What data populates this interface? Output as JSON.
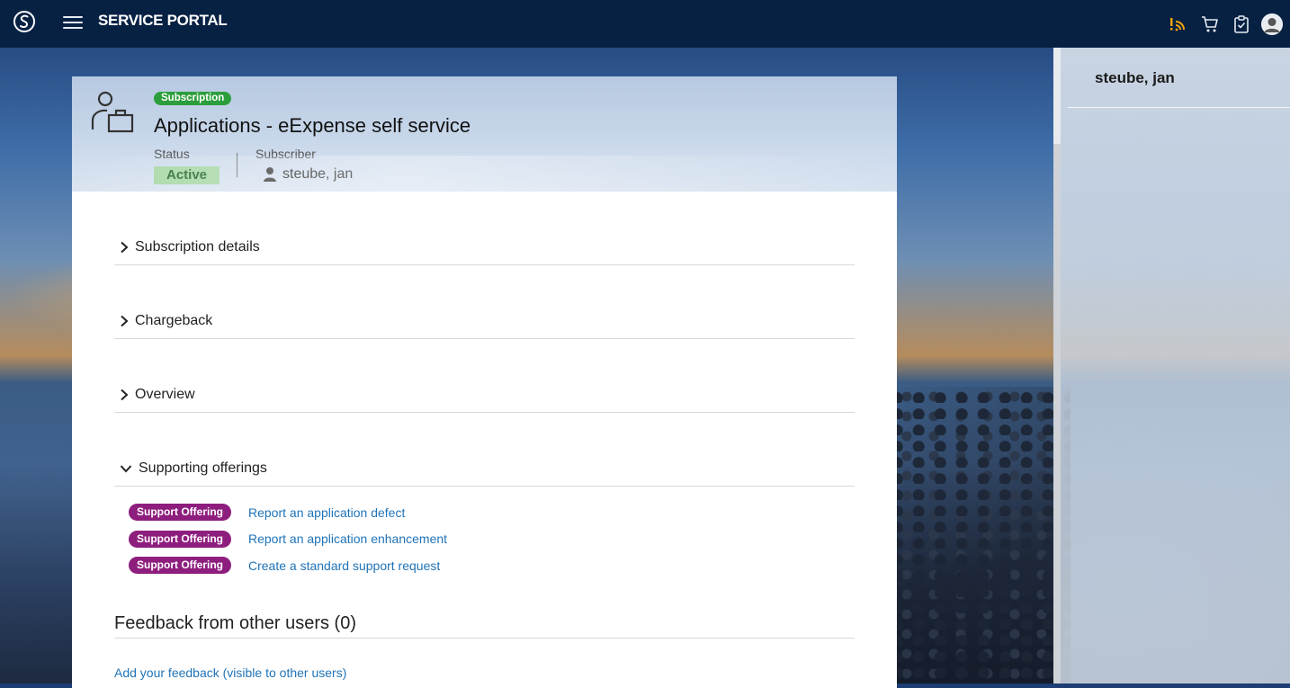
{
  "header": {
    "brand": "SERVICE PORTAL",
    "icons": [
      "servicenow-logo-icon",
      "menu-icon",
      "notifications-icon",
      "cart-icon",
      "requests-clipboard-icon",
      "user-avatar-icon"
    ],
    "accent_notification": "#f0a30a"
  },
  "subscription": {
    "badge": "Subscription",
    "title": "Applications - eExpense self service",
    "status_label": "Status",
    "status_value": "Active",
    "subscriber_label": "Subscriber",
    "subscriber_value": "steube, jan"
  },
  "sections": [
    {
      "label": "Subscription details",
      "expanded": false
    },
    {
      "label": "Chargeback",
      "expanded": false
    },
    {
      "label": "Overview",
      "expanded": false
    },
    {
      "label": "Supporting offerings",
      "expanded": true
    }
  ],
  "offerings": [
    {
      "badge": "Support Offering",
      "link": "Report an application defect"
    },
    {
      "badge": "Support Offering",
      "link": "Report an application enhancement"
    },
    {
      "badge": "Support Offering",
      "link": "Create a standard support request"
    }
  ],
  "feedback": {
    "title": "Feedback from other users (0)",
    "add_link": "Add your feedback (visible to other users)"
  },
  "right_panel": {
    "user_name": "steube, jan"
  },
  "colors": {
    "topbar": "#072143",
    "subscription_badge": "#2b9e3b",
    "support_badge": "#8e1e7e",
    "link": "#1f73b7",
    "status_bg": "#a9d9a8"
  }
}
